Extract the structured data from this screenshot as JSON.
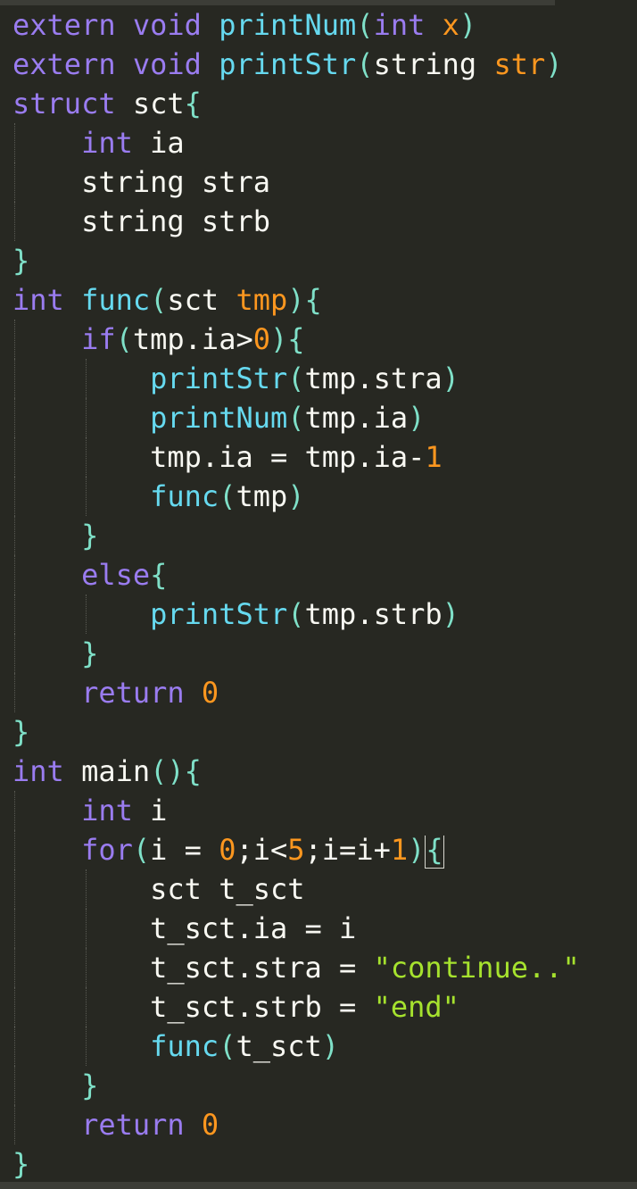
{
  "editor": {
    "lines": [
      {
        "tokens": [
          [
            "kw",
            "extern"
          ],
          [
            "p",
            " "
          ],
          [
            "kw",
            "void"
          ],
          [
            "p",
            " "
          ],
          [
            "fn",
            "printNum"
          ],
          [
            "br",
            "("
          ],
          [
            "kw",
            "int"
          ],
          [
            "p",
            " "
          ],
          [
            "arg",
            "x"
          ],
          [
            "br",
            ")"
          ]
        ]
      },
      {
        "tokens": [
          [
            "kw",
            "extern"
          ],
          [
            "p",
            " "
          ],
          [
            "kw",
            "void"
          ],
          [
            "p",
            " "
          ],
          [
            "fn",
            "printStr"
          ],
          [
            "br",
            "("
          ],
          [
            "p",
            "string"
          ],
          [
            "p",
            " "
          ],
          [
            "arg",
            "str"
          ],
          [
            "br",
            ")"
          ]
        ]
      },
      {
        "tokens": [
          [
            "kw",
            "struct"
          ],
          [
            "p",
            " "
          ],
          [
            "p",
            "sct"
          ],
          [
            "br",
            "{"
          ]
        ]
      },
      {
        "tokens": [
          [
            "p",
            "    "
          ],
          [
            "kw",
            "int"
          ],
          [
            "p",
            " ia"
          ]
        ]
      },
      {
        "tokens": [
          [
            "p",
            "    string stra"
          ]
        ]
      },
      {
        "tokens": [
          [
            "p",
            "    string strb"
          ]
        ]
      },
      {
        "tokens": [
          [
            "br",
            "}"
          ]
        ]
      },
      {
        "tokens": [
          [
            "kw",
            "int"
          ],
          [
            "p",
            " "
          ],
          [
            "fn",
            "func"
          ],
          [
            "br",
            "("
          ],
          [
            "p",
            "sct "
          ],
          [
            "arg",
            "tmp"
          ],
          [
            "br",
            ")"
          ],
          [
            "br",
            "{"
          ]
        ]
      },
      {
        "tokens": [
          [
            "p",
            "    "
          ],
          [
            "kw",
            "if"
          ],
          [
            "br",
            "("
          ],
          [
            "p",
            "tmp.ia>"
          ],
          [
            "num",
            "0"
          ],
          [
            "br",
            ")"
          ],
          [
            "br",
            "{"
          ]
        ]
      },
      {
        "tokens": [
          [
            "p",
            "        "
          ],
          [
            "fn",
            "printStr"
          ],
          [
            "br",
            "("
          ],
          [
            "p",
            "tmp.stra"
          ],
          [
            "br",
            ")"
          ]
        ]
      },
      {
        "tokens": [
          [
            "p",
            "        "
          ],
          [
            "fn",
            "printNum"
          ],
          [
            "br",
            "("
          ],
          [
            "p",
            "tmp.ia"
          ],
          [
            "br",
            ")"
          ]
        ]
      },
      {
        "tokens": [
          [
            "p",
            "        tmp.ia = tmp.ia-"
          ],
          [
            "num",
            "1"
          ]
        ]
      },
      {
        "tokens": [
          [
            "p",
            "        "
          ],
          [
            "fn",
            "func"
          ],
          [
            "br",
            "("
          ],
          [
            "p",
            "tmp"
          ],
          [
            "br",
            ")"
          ]
        ]
      },
      {
        "tokens": [
          [
            "p",
            "    "
          ],
          [
            "br",
            "}"
          ]
        ]
      },
      {
        "tokens": [
          [
            "p",
            "    "
          ],
          [
            "kw",
            "else"
          ],
          [
            "br",
            "{"
          ]
        ]
      },
      {
        "tokens": [
          [
            "p",
            "        "
          ],
          [
            "fn",
            "printStr"
          ],
          [
            "br",
            "("
          ],
          [
            "p",
            "tmp.strb"
          ],
          [
            "br",
            ")"
          ]
        ]
      },
      {
        "tokens": [
          [
            "p",
            "    "
          ],
          [
            "br",
            "}"
          ]
        ]
      },
      {
        "tokens": [
          [
            "p",
            "    "
          ],
          [
            "kw",
            "return"
          ],
          [
            "p",
            " "
          ],
          [
            "num",
            "0"
          ]
        ]
      },
      {
        "tokens": [
          [
            "br",
            "}"
          ]
        ]
      },
      {
        "tokens": [
          [
            "kw",
            "int"
          ],
          [
            "p",
            " main"
          ],
          [
            "br",
            "("
          ],
          [
            "br",
            ")"
          ],
          [
            "br",
            "{"
          ]
        ]
      },
      {
        "tokens": [
          [
            "p",
            "    "
          ],
          [
            "kw",
            "int"
          ],
          [
            "p",
            " i"
          ]
        ]
      },
      {
        "tokens": [
          [
            "p",
            "    "
          ],
          [
            "kw",
            "for"
          ],
          [
            "br",
            "("
          ],
          [
            "p",
            "i = "
          ],
          [
            "num",
            "0"
          ],
          [
            "p",
            ";i<"
          ],
          [
            "num",
            "5"
          ],
          [
            "p",
            ";i=i+"
          ],
          [
            "num",
            "1"
          ],
          [
            "br",
            ")"
          ],
          [
            "cur",
            "{"
          ]
        ]
      },
      {
        "tokens": [
          [
            "p",
            "        sct t_sct"
          ]
        ]
      },
      {
        "tokens": [
          [
            "p",
            "        t_sct.ia = i"
          ]
        ]
      },
      {
        "tokens": [
          [
            "p",
            "        t_sct.stra = "
          ],
          [
            "str",
            "\"continue..\""
          ]
        ]
      },
      {
        "tokens": [
          [
            "p",
            "        t_sct.strb = "
          ],
          [
            "str",
            "\"end\""
          ]
        ]
      },
      {
        "tokens": [
          [
            "p",
            "        "
          ],
          [
            "fn",
            "func"
          ],
          [
            "br",
            "("
          ],
          [
            "p",
            "t_sct"
          ],
          [
            "br",
            ")"
          ]
        ]
      },
      {
        "tokens": [
          [
            "p",
            "    "
          ],
          [
            "br",
            "}"
          ]
        ]
      },
      {
        "tokens": [
          [
            "p",
            "    "
          ],
          [
            "kw",
            "return"
          ],
          [
            "p",
            " "
          ],
          [
            "num",
            "0"
          ]
        ]
      },
      {
        "tokens": [
          [
            "br",
            "}"
          ]
        ]
      }
    ]
  },
  "colors": {
    "background": "#272822",
    "keyword": "#9a7cf0",
    "function": "#66d9ef",
    "number": "#fd971f",
    "string": "#a6e22e",
    "brace": "#7fe0c8",
    "text": "#f8f8f2"
  }
}
